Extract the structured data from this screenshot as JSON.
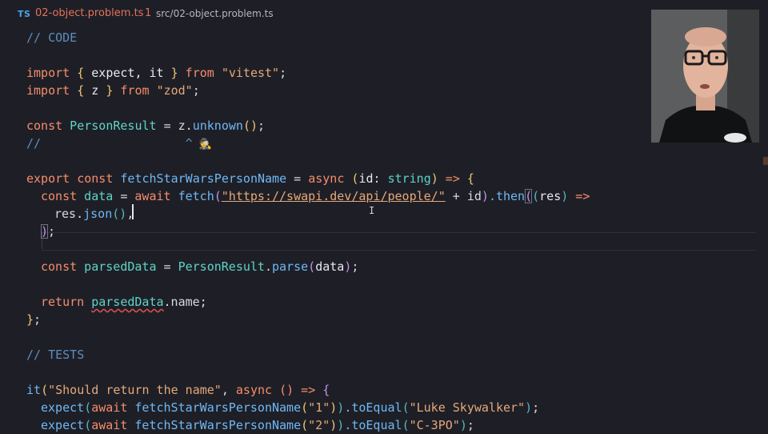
{
  "tab": {
    "icon": "TS",
    "filename": "02-object.problem.ts",
    "problem_count": "1",
    "path": "src/02-object.problem.ts"
  },
  "code": {
    "l1": "// CODE",
    "l3a": "import",
    "l3b": "{",
    "l3c": " expect, it ",
    "l3d": "}",
    "l3e": " from ",
    "l3f": "\"vitest\"",
    "l3g": ";",
    "l4a": "import",
    "l4b": "{",
    "l4c": " z ",
    "l4d": "}",
    "l4e": " from ",
    "l4f": "\"zod\"",
    "l4g": ";",
    "l6a": "const",
    "l6b": " PersonResult ",
    "l6c": "= z.",
    "l6d": "unknown",
    "l6e": "()",
    "l6f": ";",
    "l7a": "//",
    "l7b": "                    ^",
    "l7c": " 🕵️",
    "l9a": "export",
    "l9b": " const ",
    "l9c": "fetchStarWarsPersonName",
    "l9d": " = ",
    "l9e": "async",
    "l9f": " (",
    "l9g": "id",
    "l9h": ": ",
    "l9i": "string",
    "l9j": ")",
    "l9k": " => ",
    "l9l": "{",
    "l10a": "const",
    "l10b": " data ",
    "l10c": "= ",
    "l10d": "await",
    "l10e": " fetch",
    "l10f": "(",
    "l10g": "\"https://swapi.dev/api/people/\"",
    "l10h": " + id",
    "l10i": ")",
    "l10j": ".then",
    "l10k": "(",
    "l10l": "(",
    "l10m": "res",
    "l10n": ")",
    "l10o": " =>",
    "l11a": "res.",
    "l11b": "json",
    "l11c": "()",
    "l11d": ",",
    "l12a": ")",
    "l12b": ";",
    "l14a": "const",
    "l14b": " parsedData ",
    "l14c": "= ",
    "l14d": "PersonResult",
    "l14e": ".",
    "l14f": "parse",
    "l14g": "(",
    "l14h": "data",
    "l14i": ")",
    "l14j": ";",
    "l16a": "return",
    "l16b": "parsedData",
    "l16c": ".name;",
    "l17a": "}",
    "l17b": ";",
    "l19": "// TESTS",
    "l21a": "it",
    "l21b": "(",
    "l21c": "\"Should return the name\"",
    "l21d": ", ",
    "l21e": "async",
    "l21f": " () => ",
    "l21g": "{",
    "l22a": "expect",
    "l22b": "(",
    "l22c": "await",
    "l22d": " fetchStarWarsPersonName",
    "l22e": "(",
    "l22f": "\"1\"",
    "l22g": ")",
    "l22h": ")",
    "l22i": ".toEqual",
    "l22j": "(",
    "l22k": "\"Luke Skywalker\"",
    "l22l": ")",
    "l22m": ";",
    "l23a": "expect",
    "l23b": "(",
    "l23c": "await",
    "l23d": " fetchStarWarsPersonName",
    "l23e": "(",
    "l23f": "\"2\"",
    "l23g": ")",
    "l23h": ")",
    "l23i": ".toEqual",
    "l23j": "(",
    "l23k": "\"C-3PO\"",
    "l23l": ")",
    "l23m": ";"
  },
  "colors": {
    "background": "#1e1f26",
    "keyword": "#f78c6c",
    "string": "#e5a87a",
    "comment": "#5c8ebf",
    "function": "#6fb8f5",
    "error_squiggle": "#e05252",
    "tab_error": "#e2725b"
  },
  "icons": [
    "typescript-file-icon",
    "i-beam-cursor-icon",
    "detective-emoji-icon"
  ]
}
